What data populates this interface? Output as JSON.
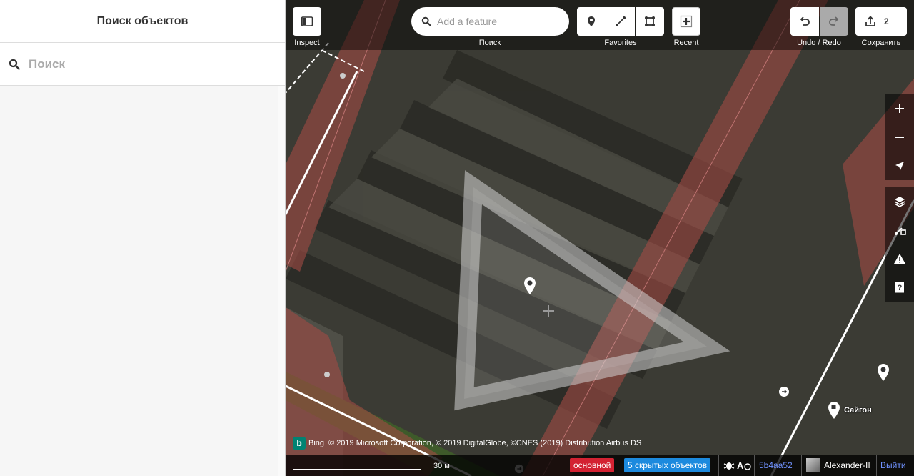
{
  "sidebar": {
    "title": "Поиск объектов",
    "search_placeholder": "Поиск"
  },
  "toolbar": {
    "inspect_label": "Inspect",
    "search_label": "Поиск",
    "search_placeholder": "Add a feature",
    "favorites_label": "Favorites",
    "recent_label": "Recent",
    "undo_redo_label": "Undo / Redo",
    "save_label": "Сохранить",
    "save_count": "2"
  },
  "map": {
    "poi_label": "Сайгон"
  },
  "attribution": {
    "text": "© 2019 Microsoft Corporation, © 2019 DigitalGlobe, ©CNES (2019) Distribution Airbus DS",
    "logo_text": "Bing"
  },
  "footer": {
    "scale_text": "30 м",
    "branch_badge": "основной",
    "hidden_badge": "5 скрытых объектов",
    "version": "5b4aa52",
    "username": "Alexander-II",
    "logout": "Выйти"
  },
  "colors": {
    "branch_badge": "#d32232",
    "hidden_badge": "#1c8ade",
    "link": "#7092ff"
  }
}
